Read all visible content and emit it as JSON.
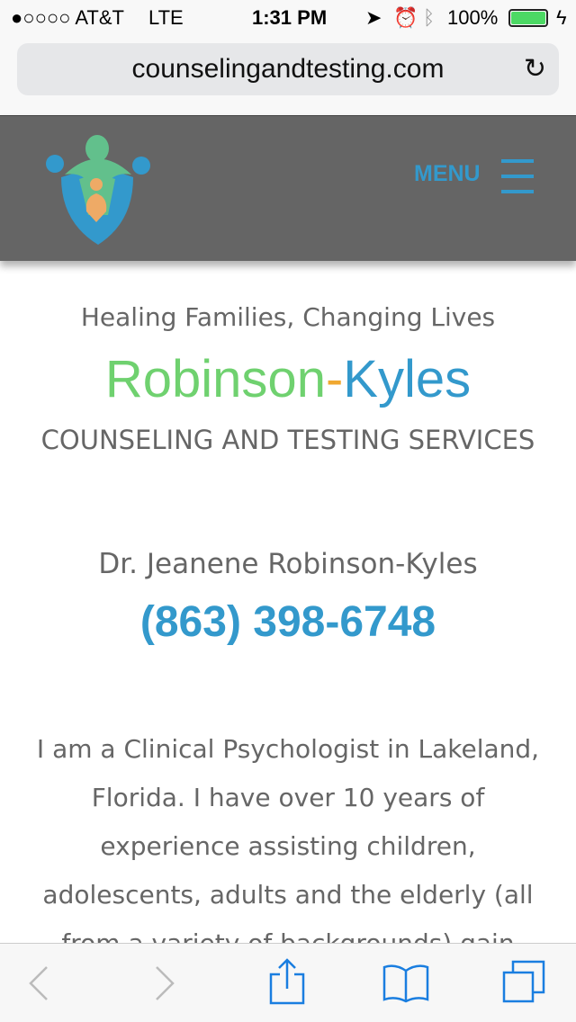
{
  "status": {
    "carrier": "●○○○○ AT&T",
    "network": "LTE",
    "time": "1:31 PM",
    "battery": "100%"
  },
  "browser": {
    "url": "counselingandtesting.com"
  },
  "header": {
    "menu_label": "MENU"
  },
  "hero": {
    "tagline": "Healing Families, Changing Lives",
    "name_part1": "Robinson",
    "name_dash": "-",
    "name_part2": "Kyles",
    "subtitle": "COUNSELING AND TESTING SERVICES"
  },
  "contact": {
    "doctor": "Dr. Jeanene Robinson-Kyles",
    "phone": "(863) 398-6748"
  },
  "intro": "I am a Clinical Psychologist in Lakeland, Florida. I have over 10 years of experience assisting children, adolescents, adults and the elderly (all from a variety of backgrounds) gain",
  "colors": {
    "green": "#6fd16f",
    "orange": "#f0a830",
    "blue": "#3399cc",
    "header": "#656565"
  }
}
